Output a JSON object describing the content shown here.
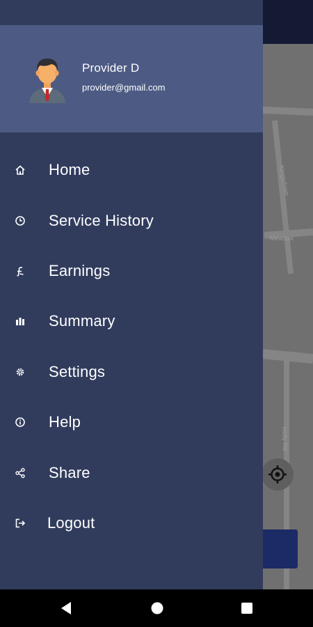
{
  "profile": {
    "name": "Provider D",
    "email": "provider@gmail.com"
  },
  "menu": {
    "items": [
      {
        "label": "Home",
        "icon": "home-icon"
      },
      {
        "label": "Service History",
        "icon": "clock-icon"
      },
      {
        "label": "Earnings",
        "icon": "currency-icon"
      },
      {
        "label": "Summary",
        "icon": "bar-chart-icon"
      },
      {
        "label": "Settings",
        "icon": "gear-icon"
      },
      {
        "label": "Help",
        "icon": "info-icon"
      },
      {
        "label": "Share",
        "icon": "share-icon"
      },
      {
        "label": "Logout",
        "icon": "logout-icon"
      }
    ]
  },
  "map": {
    "street_labels": [
      "Kingsdown",
      "Meadow",
      "Holly Rd"
    ]
  },
  "navigation": {
    "buttons": [
      "back-icon",
      "home-circle-icon",
      "recents-icon"
    ]
  },
  "colors": {
    "drawer_bg": "#313c5d",
    "header_bg": "#4d5b84",
    "map_bg": "#707070",
    "topbar_bg": "#141a33",
    "accent_button": "#1c2a66"
  }
}
